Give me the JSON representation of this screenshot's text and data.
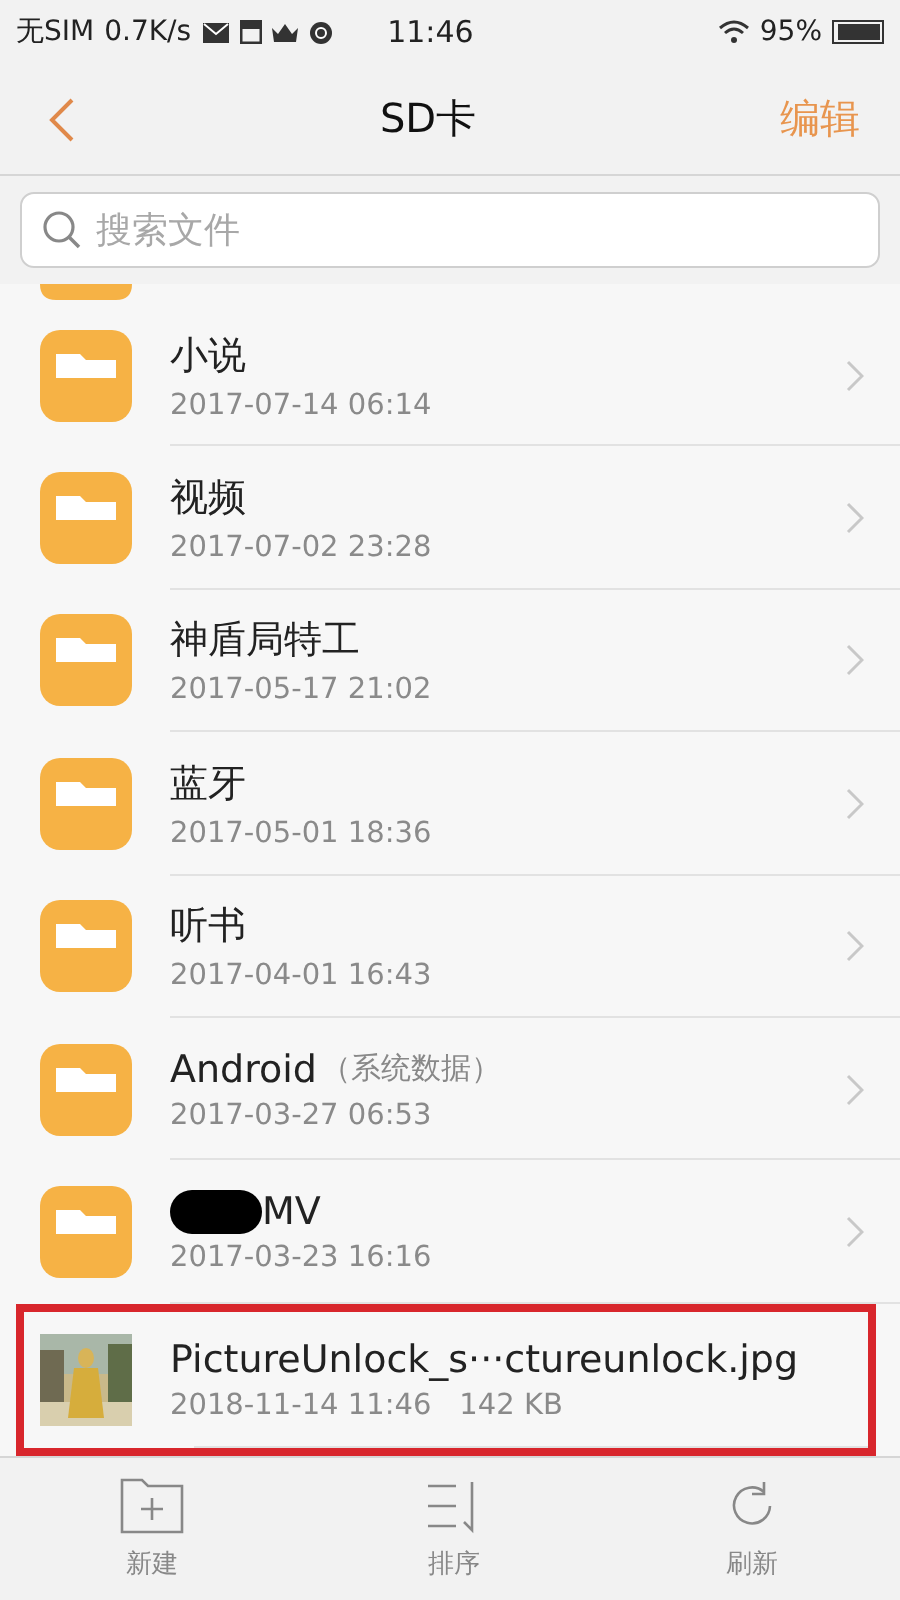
{
  "status_bar": {
    "carrier": "无SIM",
    "speed": "0.7K/s",
    "time": "11:46",
    "battery": "95%"
  },
  "nav": {
    "title": "SD卡",
    "action": "编辑"
  },
  "search": {
    "placeholder": "搜索文件"
  },
  "items": [
    {
      "kind": "folder",
      "name": "小说",
      "date": "2017-07-14 06:14"
    },
    {
      "kind": "folder",
      "name": "视频",
      "date": "2017-07-02 23:28"
    },
    {
      "kind": "folder",
      "name": "神盾局特工",
      "date": "2017-05-17 21:02"
    },
    {
      "kind": "folder",
      "name": "蓝牙",
      "date": "2017-05-01 18:36"
    },
    {
      "kind": "folder",
      "name": "听书",
      "date": "2017-04-01 16:43"
    },
    {
      "kind": "folder",
      "name": "Android",
      "note": "（系统数据）",
      "date": "2017-03-27 06:53"
    },
    {
      "kind": "folder",
      "name": "MV",
      "redacted": true,
      "date": "2017-03-23 16:16"
    },
    {
      "kind": "file",
      "name": "PictureUnlock_s···ctureunlock.jpg",
      "date": "2018-11-14 11:46",
      "size": "142 KB",
      "highlighted": true
    }
  ],
  "toolbar": [
    {
      "kind": "new",
      "label": "新建"
    },
    {
      "kind": "sort",
      "label": "排序"
    },
    {
      "kind": "refresh",
      "label": "刷新"
    }
  ]
}
